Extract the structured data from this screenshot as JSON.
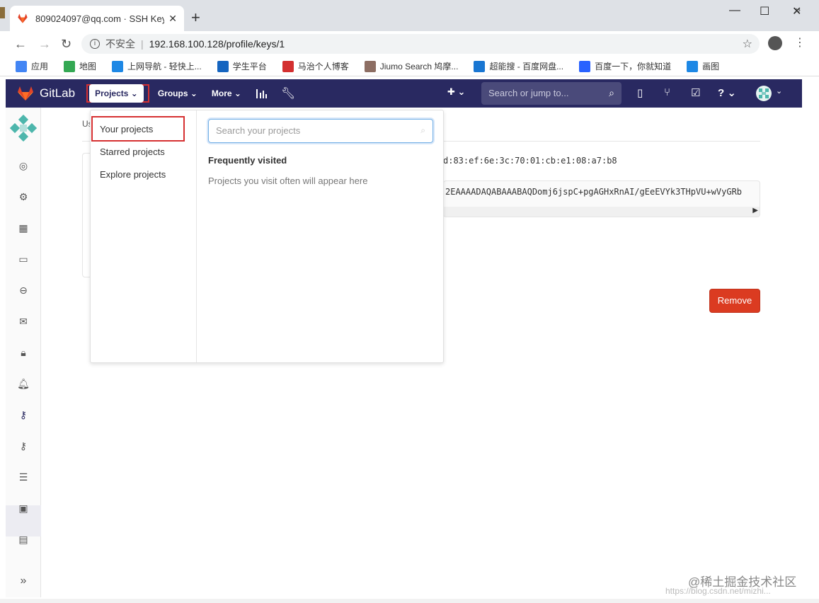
{
  "browser": {
    "tab_title": "809024097@qq.com · SSH Key",
    "new_tab": "+",
    "close_tab": "✕",
    "window_min": "—",
    "window_max": "☐",
    "window_close": "✕",
    "address": {
      "insecure_label": "不安全",
      "separator": "|",
      "url": "192.168.100.128/profile/keys/1"
    },
    "bookmarks": [
      {
        "label": "应用",
        "icon": "apps-grid-icon",
        "color": "#4285f4"
      },
      {
        "label": "地图",
        "icon": "maps-icon",
        "color": "#34a853"
      },
      {
        "label": "上网导航 - 轻快上...",
        "icon": "nav-icon",
        "color": "#1e88e5"
      },
      {
        "label": "学生平台",
        "icon": "student-icon",
        "color": "#1565c0"
      },
      {
        "label": "马治个人博客",
        "icon": "blog-c-icon",
        "color": "#d32f2f"
      },
      {
        "label": "Jiumo Search 鸠摩...",
        "icon": "jiumo-icon",
        "color": "#8d6e63"
      },
      {
        "label": "超能搜 - 百度网盘...",
        "icon": "search-q-icon",
        "color": "#1976d2"
      },
      {
        "label": "百度一下，你就知道",
        "icon": "baidu-paw-icon",
        "color": "#2962ff"
      },
      {
        "label": "画图",
        "icon": "on-draw-icon",
        "color": "#1e88e5"
      }
    ],
    "bookmarks_more": "»"
  },
  "gitlab": {
    "brand": "GitLab",
    "nav": {
      "projects": "Projects ⌄",
      "groups": "Groups ⌄",
      "more": "More ⌄",
      "search_placeholder": "Search or jump to...",
      "plus": "✚ ⌄",
      "help": "? ⌄"
    },
    "colors": {
      "navbar": "#292961",
      "danger": "#db3b21",
      "highlight": "#d63031"
    }
  },
  "page": {
    "tab_fragment": "Us",
    "fingerprint": "d:83:ef:6e:3c:70:01:cb:e1:08:a7:b8",
    "key_text": "2EAAAADAQABAAABAQDomj6jspC+pgAGHxRnAI/gEeEVYk3THpVU+wVyGRb",
    "remove_button": "Remove"
  },
  "dropdown": {
    "items": [
      "Your projects",
      "Starred projects",
      "Explore projects"
    ],
    "search_placeholder": "Search your projects",
    "frequent_heading": "Frequently visited",
    "frequent_empty": "Projects you visit often will appear here"
  },
  "watermark": {
    "line1": "@稀土掘金技术社区",
    "line2": "https://blog.csdn.net/mizhi..."
  }
}
